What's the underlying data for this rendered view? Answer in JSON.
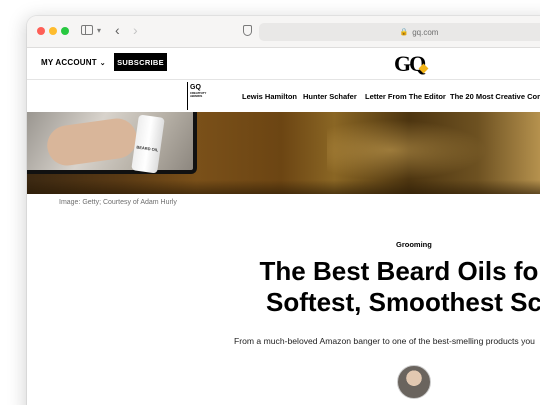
{
  "browser": {
    "url": "gq.com"
  },
  "header": {
    "my_account": "MY ACCOUNT",
    "subscribe": "SUBSCRIBE",
    "logo": "GQ"
  },
  "nav": {
    "items": [
      "Lewis Hamilton",
      "Hunter Schafer",
      "Letter From The Editor",
      "The 20 Most Creative Com"
    ]
  },
  "hero": {
    "bottle_label": "BEARD OIL",
    "caption": "Image: Getty; Courtesy of Adam Hurly"
  },
  "article": {
    "rubric": "Grooming",
    "headline_line1": "The Best Beard Oils for",
    "headline_line2": "Softest, Smoothest Sc",
    "dek": "From a much-beloved Amazon banger to one of the best-smelling products you"
  },
  "colors": {
    "traffic_red": "#fe5f57",
    "traffic_yellow": "#febc2e",
    "traffic_green": "#28c840",
    "gq_accent": "#f3b418"
  }
}
